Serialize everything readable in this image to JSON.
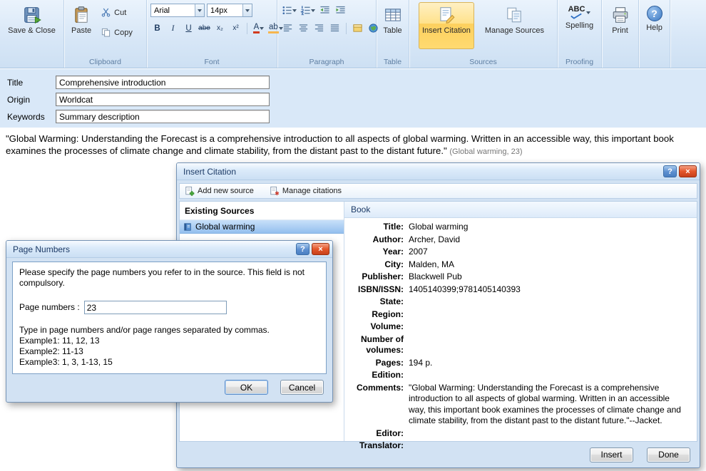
{
  "window_controls": {
    "help_glyph": "?",
    "close_glyph": "×"
  },
  "ribbon": {
    "save_close": {
      "label": "Save & Close"
    },
    "clipboard": {
      "label": "Clipboard",
      "paste": "Paste",
      "cut": "Cut",
      "copy": "Copy"
    },
    "font": {
      "label": "Font",
      "family_value": "Arial",
      "size_value": "14px",
      "bold": "B",
      "italic": "I",
      "underline": "U",
      "strikethrough": "abe",
      "subscript": "x₂",
      "superscript": "x²",
      "font_color": "A",
      "highlight": "ab"
    },
    "paragraph": {
      "label": "Paragraph"
    },
    "table": {
      "label": "Table",
      "button": "Table"
    },
    "sources": {
      "label": "Sources",
      "insert_citation": "Insert Citation",
      "manage_sources": "Manage Sources"
    },
    "proofing": {
      "label": "Proofing",
      "spelling": "Spelling",
      "abc": "ABC"
    },
    "print": {
      "label": "Print"
    },
    "help": {
      "label": "Help",
      "glyph": "?"
    }
  },
  "form": {
    "title_label": "Title",
    "title_value": "Comprehensive introduction",
    "origin_label": "Origin",
    "origin_value": "Worldcat",
    "keywords_label": "Keywords",
    "keywords_value": "Summary description"
  },
  "document": {
    "quote": "\"Global Warming: Understanding the Forecast is a comprehensive introduction to all aspects of global warming. Written in an accessible way, this important book examines the processes of climate change and climate stability, from the distant past to the distant future.\"",
    "citation": "(Global warming, 23)"
  },
  "insert_citation_dialog": {
    "title": "Insert Citation",
    "toolbar": {
      "add_new_source": "Add new source",
      "manage_citations": "Manage citations"
    },
    "existing_sources_header": "Existing Sources",
    "sources": [
      {
        "name": "Global warming"
      }
    ],
    "book_header": "Book",
    "fields": [
      {
        "label": "Title:",
        "value": "Global warming"
      },
      {
        "label": "Author:",
        "value": "Archer, David"
      },
      {
        "label": "Year:",
        "value": "2007"
      },
      {
        "label": "City:",
        "value": "Malden, MA"
      },
      {
        "label": "Publisher:",
        "value": "Blackwell Pub"
      },
      {
        "label": "ISBN/ISSN:",
        "value": "1405140399;9781405140393"
      },
      {
        "label": "State:",
        "value": ""
      },
      {
        "label": "Region:",
        "value": ""
      },
      {
        "label": "Volume:",
        "value": ""
      },
      {
        "label": "Number of volumes:",
        "value": ""
      },
      {
        "label": "Pages:",
        "value": "194 p."
      },
      {
        "label": "Edition:",
        "value": ""
      },
      {
        "label": "Comments:",
        "value": "\"Global Warming: Understanding the Forecast is a comprehensive introduction to all aspects of global warming. Written in an accessible way, this important book examines the processes of climate change and climate stability, from the distant past to the distant future.\"--Jacket."
      },
      {
        "label": "Editor:",
        "value": ""
      },
      {
        "label": "Translator:",
        "value": ""
      }
    ],
    "insert_button": "Insert",
    "done_button": "Done"
  },
  "page_numbers_dialog": {
    "title": "Page Numbers",
    "instruction": "Please specify the page numbers you refer to in the source. This field is not compulsory.",
    "input_label": "Page numbers :",
    "input_value": "23",
    "hint": "Type in page numbers and/or page ranges separated by commas.",
    "examples": [
      "Example1: 11, 12, 13",
      "Example2: 11-13",
      "Example3: 1, 3, 1-13, 15"
    ],
    "ok_button": "OK",
    "cancel_button": "Cancel"
  }
}
